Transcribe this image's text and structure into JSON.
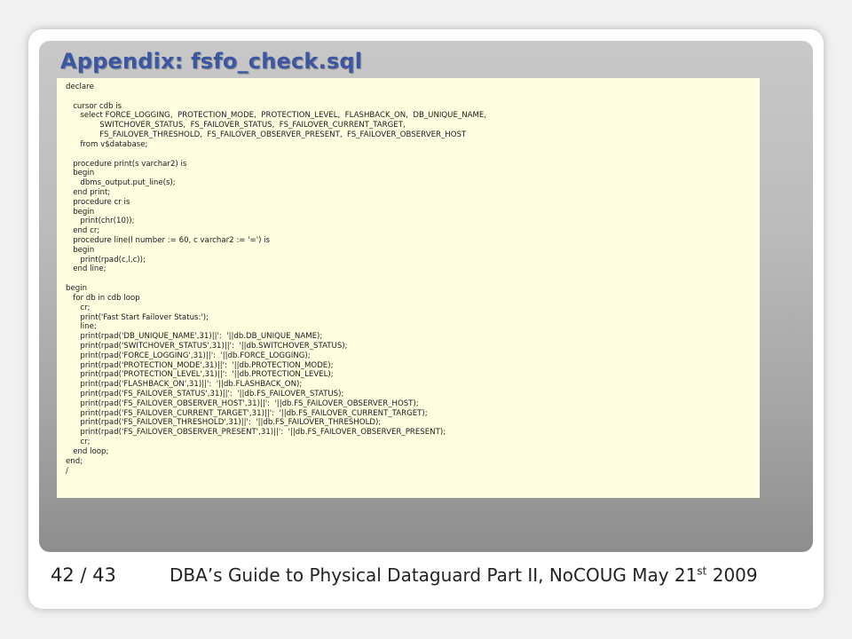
{
  "slide": {
    "title": "Appendix: fsfo_check.sql",
    "code_lines": [
      "declare",
      "",
      "   cursor cdb is",
      "      select FORCE_LOGGING,  PROTECTION_MODE,  PROTECTION_LEVEL,  FLASHBACK_ON,  DB_UNIQUE_NAME,",
      "              SWITCHOVER_STATUS,  FS_FAILOVER_STATUS,  FS_FAILOVER_CURRENT_TARGET,",
      "              FS_FAILOVER_THRESHOLD,  FS_FAILOVER_OBSERVER_PRESENT,  FS_FAILOVER_OBSERVER_HOST",
      "      from v$database;",
      "",
      "   procedure print(s varchar2) is",
      "   begin",
      "      dbms_output.put_line(s);",
      "   end print;",
      "   procedure cr is",
      "   begin",
      "      print(chr(10));",
      "   end cr;",
      "   procedure line(l number := 60, c varchar2 := '=') is",
      "   begin",
      "      print(rpad(c,l,c));",
      "   end line;",
      "",
      "begin",
      "   for db in cdb loop",
      "      cr;",
      "      print('Fast Start Failover Status:');",
      "      line;",
      "      print(rpad('DB_UNIQUE_NAME',31)||':  '||db.DB_UNIQUE_NAME);",
      "      print(rpad('SWITCHOVER_STATUS',31)||':  '||db.SWITCHOVER_STATUS);",
      "      print(rpad('FORCE_LOGGING',31)||':  '||db.FORCE_LOGGING);",
      "      print(rpad('PROTECTION_MODE',31)||':  '||db.PROTECTION_MODE);",
      "      print(rpad('PROTECTION_LEVEL',31)||':  '||db.PROTECTION_LEVEL);",
      "      print(rpad('FLASHBACK_ON',31)||':  '||db.FLASHBACK_ON);",
      "      print(rpad('FS_FAILOVER_STATUS',31)||':  '||db.FS_FAILOVER_STATUS);",
      "      print(rpad('FS_FAILOVER_OBSERVER_HOST',31)||':  '||db.FS_FAILOVER_OBSERVER_HOST);",
      "      print(rpad('FS_FAILOVER_CURRENT_TARGET',31)||':  '||db.FS_FAILOVER_CURRENT_TARGET);",
      "      print(rpad('FS_FAILOVER_THRESHOLD',31)||':  '||db.FS_FAILOVER_THRESHOLD);",
      "      print(rpad('FS_FAILOVER_OBSERVER_PRESENT',31)||':  '||db.FS_FAILOVER_OBSERVER_PRESENT);",
      "      cr;",
      "   end loop;",
      "end;",
      "/"
    ]
  },
  "footer": {
    "page": "42 / 43",
    "caption": "DBA’s Guide to Physical Dataguard Part II, NoCOUG May 21",
    "caption_sup": "st",
    "caption_year": " 2009"
  },
  "colors": {
    "title": "#3b57a3",
    "code_background": "#fffde0",
    "panel": "#b8b8b8"
  }
}
